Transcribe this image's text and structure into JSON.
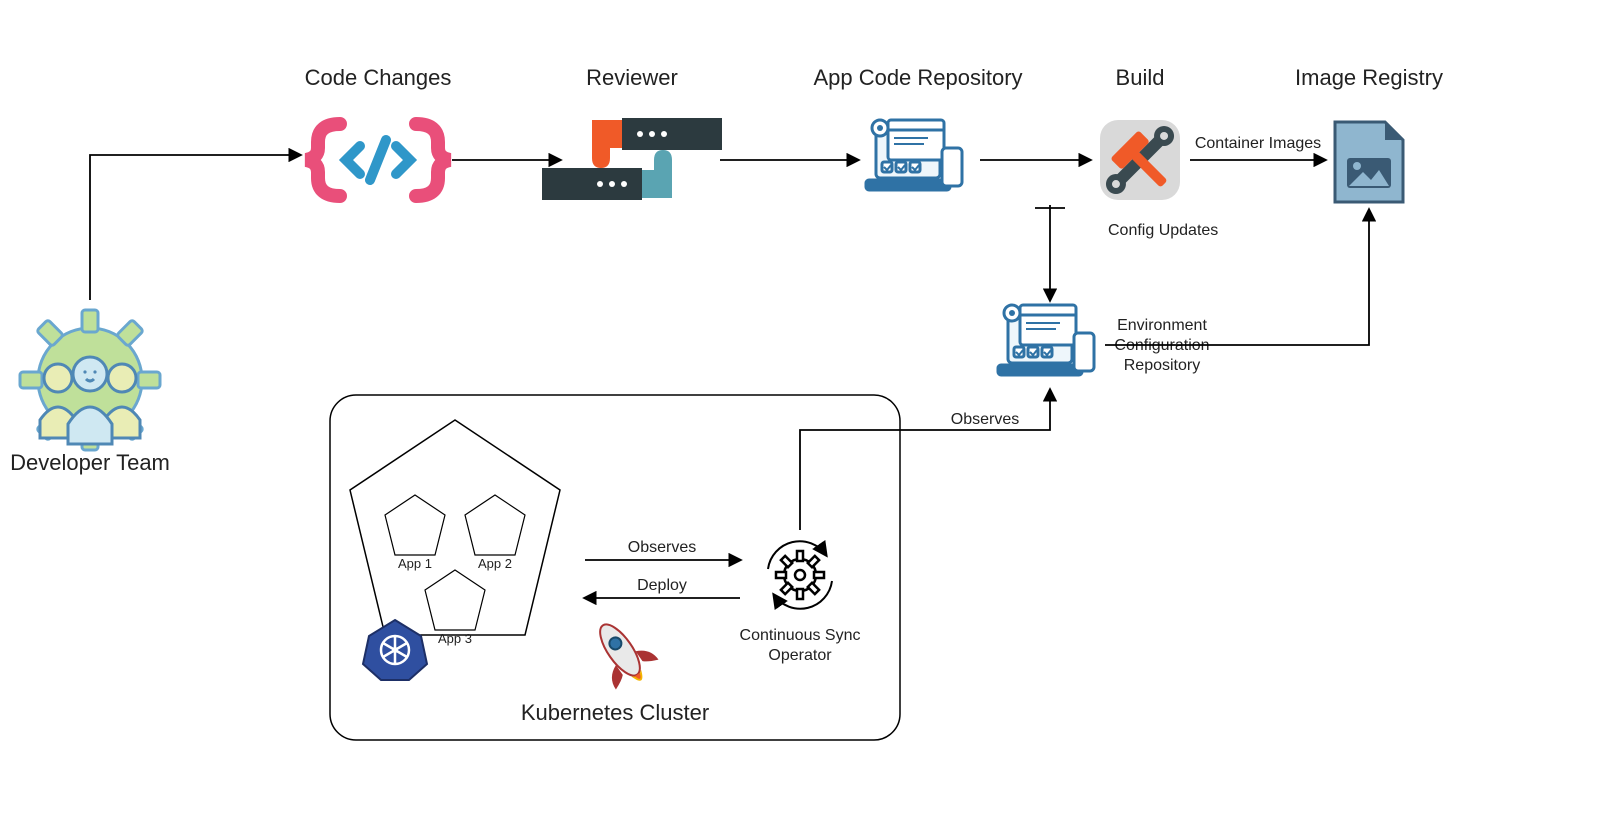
{
  "stages": {
    "developer_team": "Developer Team",
    "code_changes": "Code Changes",
    "reviewer": "Reviewer",
    "app_repo": "App Code Repository",
    "build": "Build",
    "image_registry": "Image Registry",
    "env_repo_l1": "Environment",
    "env_repo_l2": "Configuration",
    "env_repo_l3": "Repository",
    "k8s_cluster": "Kubernetes Cluster",
    "sync_op_l1": "Continuous Sync",
    "sync_op_l2": "Operator"
  },
  "edges": {
    "container_images": "Container Images",
    "config_updates": "Config Updates",
    "observes": "Observes",
    "deploy": "Deploy"
  },
  "apps": {
    "app1": "App 1",
    "app2": "App 2",
    "app3": "App 3"
  }
}
